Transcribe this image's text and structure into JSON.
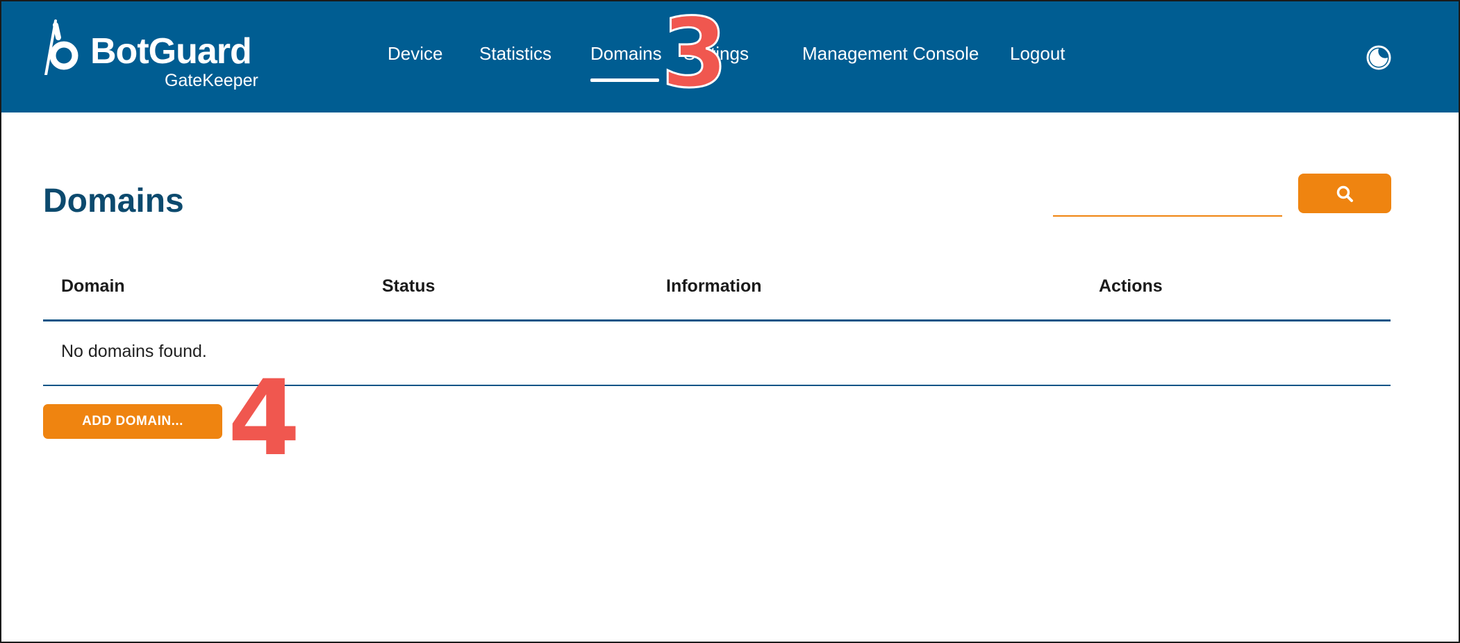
{
  "header": {
    "brand": {
      "name": "BotGuard",
      "subtitle": "GateKeeper"
    },
    "nav": [
      {
        "label": "Device",
        "active": false
      },
      {
        "label": "Statistics",
        "active": false
      },
      {
        "label": "Domains",
        "active": true
      },
      {
        "label": "Settings",
        "active": false
      },
      {
        "label": "Management Console",
        "active": false
      },
      {
        "label": "Logout",
        "active": false
      }
    ],
    "theme_toggle_icon": "theme-toggle-icon"
  },
  "annotations": {
    "marker_3": "3",
    "marker_4": "4"
  },
  "main": {
    "title": "Domains",
    "search": {
      "value": "",
      "placeholder": "",
      "icon": "search-icon"
    },
    "table": {
      "columns": [
        "Domain",
        "Status",
        "Information",
        "Actions"
      ],
      "rows": [],
      "empty_message": "No domains found."
    },
    "add_button_label": "ADD DOMAIN..."
  },
  "colors": {
    "header_bg": "#005d92",
    "accent": "#ef8410",
    "title": "#0c4a6e",
    "table_rule": "#0d5486",
    "annotation": "#f0574f"
  }
}
